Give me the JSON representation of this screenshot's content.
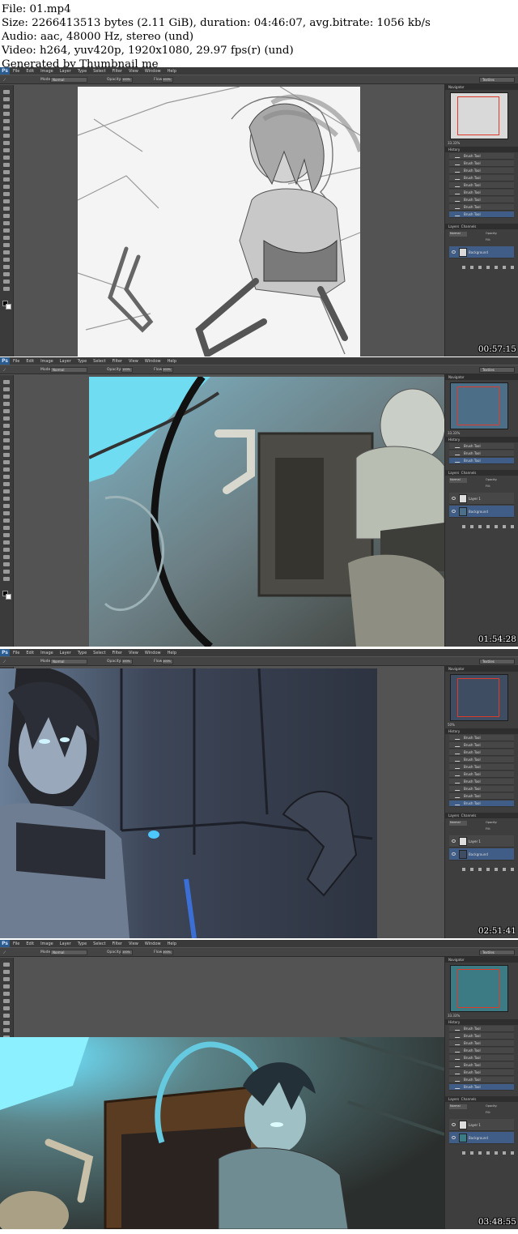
{
  "header": {
    "file": "File: 01.mp4",
    "size": "Size: 2266413513 bytes (2.11 GiB), duration: 04:46:07, avg.bitrate: 1056 kb/s",
    "audio": "Audio: aac, 48000 Hz, stereo (und)",
    "video": "Video: h264, yuv420p, 1920x1080, 29.97 fps(r) (und)",
    "generated": "Generated by Thumbnail me"
  },
  "app": {
    "logo": "Ps",
    "menu": [
      "File",
      "Edit",
      "Image",
      "Layer",
      "Type",
      "Select",
      "Filter",
      "View",
      "Window",
      "Help"
    ],
    "options": {
      "mode_label": "Mode:",
      "mode_value": "Normal",
      "opacity_label": "Opacity:",
      "opacity_value": "100%",
      "flow_label": "Flow:",
      "flow_value": "100%"
    },
    "workspace": "Textiles"
  },
  "panels": {
    "navigator": "Navigator",
    "history": "History",
    "layers": "Layers",
    "channels": "Channels",
    "history_item": "Brush Tool",
    "layer_top": "Layer 1",
    "layer_bg": "Background",
    "blend": "Normal",
    "opacity": "Opacity:",
    "fill": "Fill:"
  },
  "frames": [
    {
      "timestamp": "00:57:15",
      "zoom": "33.33%",
      "history_count": 9,
      "layer_count": 1,
      "palette": "sketch"
    },
    {
      "timestamp": "01:54:28",
      "zoom": "33.33%",
      "history_count": 3,
      "layer_count": 2,
      "palette": "cyan"
    },
    {
      "timestamp": "02:51:41",
      "zoom": "50%",
      "history_count": 10,
      "layer_count": 2,
      "palette": "dark"
    },
    {
      "timestamp": "03:48:55",
      "zoom": "33.33%",
      "history_count": 9,
      "layer_count": 2,
      "palette": "color"
    }
  ],
  "colors": {
    "ui_dark": "#3a3a3a",
    "ui_mid": "#535353",
    "ui_panel": "#3e3e3e",
    "selection": "#3f5d86",
    "navigator_box": "#e03a2a",
    "ps_blue": "#2c5b8e"
  }
}
